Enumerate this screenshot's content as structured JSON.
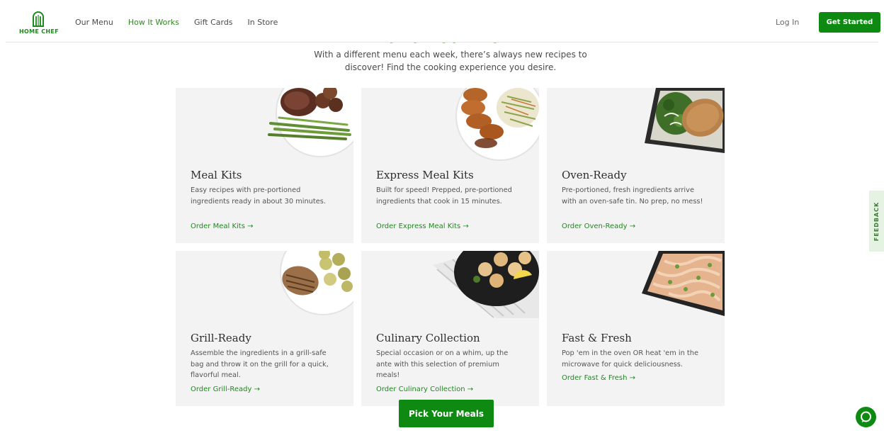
{
  "header": {
    "logo_text": "HOME CHEF",
    "nav": [
      {
        "label": "Our Menu"
      },
      {
        "label": "How It Works"
      },
      {
        "label": "Gift Cards"
      },
      {
        "label": "In Store"
      }
    ],
    "login_label": "Log In",
    "cta_label": "Get Started"
  },
  "intro": {
    "title_partial": "Build Your Box",
    "text": "With a different menu each week, there’s always new recipes to discover! Find the cooking experience you desire."
  },
  "cards": [
    {
      "title": "Meal Kits",
      "description": "Easy recipes with pre-portioned ingredients ready in about 30 minutes.",
      "link": "Order Meal Kits →",
      "image_icon": "steak-asparagus-plate"
    },
    {
      "title": "Express Meal Kits",
      "description": "Built for speed! Prepped, pre-portioned ingredients that cook in 15 minutes.",
      "link": "Order Express Meal Kits →",
      "image_icon": "pork-slaw-plate"
    },
    {
      "title": "Oven-Ready",
      "description": "Pre-portioned, fresh ingredients arrive with an oven-safe tin. No prep, no mess!",
      "link": "Order Oven-Ready →",
      "image_icon": "chicken-greens-tin"
    },
    {
      "title": "Grill-Ready",
      "description": "Assemble the ingredients in a grill-safe bag and throw it on the grill for a quick, flavorful meal.",
      "link": "Order Grill-Ready →",
      "image_icon": "grilled-chicken-zucchini-plate"
    },
    {
      "title": "Culinary Collection",
      "description": "Special occasion or on a whim, up the ante with this selection of premium meals!",
      "link": "Order Culinary Collection →",
      "image_icon": "scallops-skillet"
    },
    {
      "title": "Fast & Fresh",
      "description": "Pop 'em in the oven OR heat 'em in the microwave for quick deliciousness.",
      "link": "Order Fast & Fresh →",
      "image_icon": "pasta-tray"
    }
  ],
  "pick_button": "Pick Your Meals",
  "feedback_label": "FEEDBACK",
  "colors": {
    "brand_green": "#0e8a12",
    "card_bg": "#f3f3f4"
  }
}
